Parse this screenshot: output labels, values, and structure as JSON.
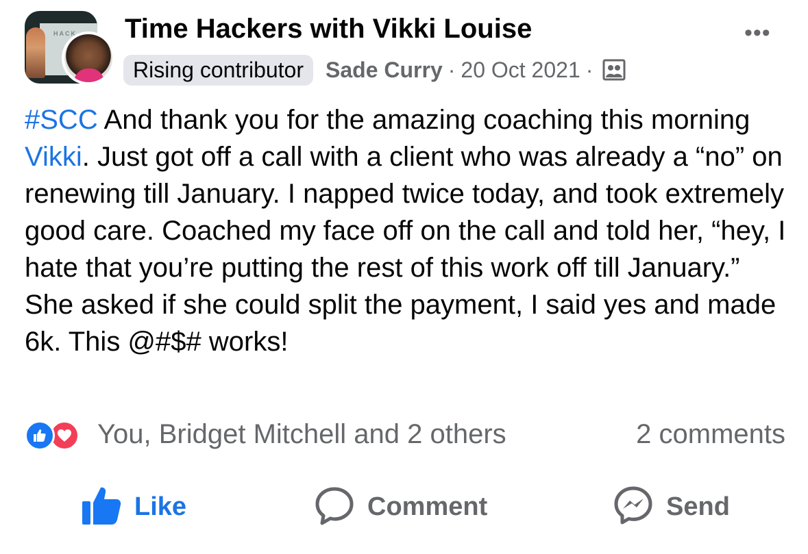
{
  "post": {
    "group_name": "Time Hackers with Vikki Louise",
    "group_thumb_text": "HACK",
    "badge": "Rising contributor",
    "author": "Sade Curry",
    "separator": "·",
    "date": "20 Oct 2021",
    "more_label": "•••",
    "audience_icon": "group-audience-icon",
    "body": {
      "hashtag": "#SCC",
      "text_1": " And thank you for the amazing coaching this morning ",
      "mention": "Vikki",
      "text_2": ". Just got off a call with a client who was already a “no” on renewing till January. I napped twice today, and took extremely good care. Coached my face off on the call and told her, “hey, I hate that you’re putting the rest of this work off till January.” She asked if she could split the payment, I said yes and made 6k. This @#$# works!"
    }
  },
  "reactions": {
    "icons": [
      "like-reaction-icon",
      "love-reaction-icon"
    ],
    "summary": "You, Bridget Mitchell and 2 others",
    "comment_count": "2 comments"
  },
  "actions": {
    "like": "Like",
    "comment": "Comment",
    "send": "Send"
  },
  "colors": {
    "link_blue": "#1b74e4",
    "like_blue": "#1877f2",
    "love_red": "#f33e58",
    "muted_gray": "#65676b",
    "badge_bg": "#e4e6eb"
  }
}
